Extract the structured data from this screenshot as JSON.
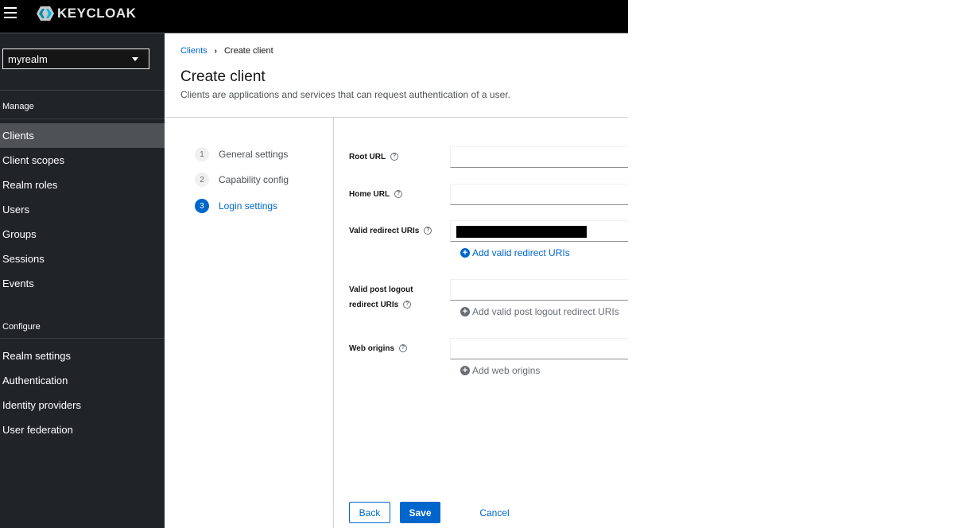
{
  "header": {
    "brand": "KEYCLOAK"
  },
  "sidebar": {
    "realm": "myrealm",
    "sections": {
      "manage": "Manage",
      "configure": "Configure"
    },
    "manage_items": [
      {
        "label": "Clients",
        "active": true
      },
      {
        "label": "Client scopes",
        "active": false
      },
      {
        "label": "Realm roles",
        "active": false
      },
      {
        "label": "Users",
        "active": false
      },
      {
        "label": "Groups",
        "active": false
      },
      {
        "label": "Sessions",
        "active": false
      },
      {
        "label": "Events",
        "active": false
      }
    ],
    "configure_items": [
      {
        "label": "Realm settings"
      },
      {
        "label": "Authentication"
      },
      {
        "label": "Identity providers"
      },
      {
        "label": "User federation"
      }
    ]
  },
  "breadcrumb": {
    "parent": "Clients",
    "current": "Create client"
  },
  "page": {
    "title": "Create client",
    "description": "Clients are applications and services that can request authentication of a user."
  },
  "wizard": {
    "steps": [
      {
        "number": "1",
        "label": "General settings",
        "current": false
      },
      {
        "number": "2",
        "label": "Capability config",
        "current": false
      },
      {
        "number": "3",
        "label": "Login settings",
        "current": true
      }
    ]
  },
  "form": {
    "help_glyph": "?",
    "add_glyph": "+",
    "root_url": {
      "label": "Root URL",
      "value": ""
    },
    "home_url": {
      "label": "Home URL",
      "value": ""
    },
    "valid_redirect_uris": {
      "label": "Valid redirect URIs",
      "add_label": "Add valid redirect URIs"
    },
    "valid_post_logout": {
      "label_line1": "Valid post logout",
      "label_line2": "redirect URIs",
      "value": "",
      "add_label": "Add valid post logout redirect URIs"
    },
    "web_origins": {
      "label": "Web origins",
      "value": "",
      "add_label": "Add web origins"
    }
  },
  "footer": {
    "back": "Back",
    "save": "Save",
    "cancel": "Cancel"
  },
  "colors": {
    "primary": "#0066cc",
    "sidebar_bg": "#212427",
    "active_nav": "#4f5255",
    "masthead": "#000000"
  }
}
